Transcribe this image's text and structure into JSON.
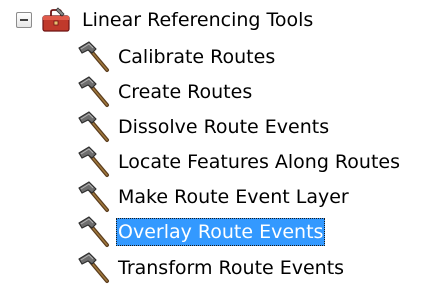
{
  "tree": {
    "toolbox": {
      "label": "Linear Referencing Tools",
      "icon": "toolbox-icon",
      "expanded": true
    },
    "tools": [
      {
        "label": "Calibrate Routes",
        "icon": "hammer-icon",
        "selected": false
      },
      {
        "label": "Create Routes",
        "icon": "hammer-icon",
        "selected": false
      },
      {
        "label": "Dissolve Route Events",
        "icon": "hammer-icon",
        "selected": false
      },
      {
        "label": "Locate Features Along Routes",
        "icon": "hammer-icon",
        "selected": false
      },
      {
        "label": "Make Route Event Layer",
        "icon": "hammer-icon",
        "selected": false
      },
      {
        "label": "Overlay Route Events",
        "icon": "hammer-icon",
        "selected": true
      },
      {
        "label": "Transform Route Events",
        "icon": "hammer-icon",
        "selected": false
      }
    ]
  },
  "colors": {
    "selection_background": "#3399ff",
    "selection_text": "#ffffff",
    "toolbox_red": "#c0392b"
  }
}
